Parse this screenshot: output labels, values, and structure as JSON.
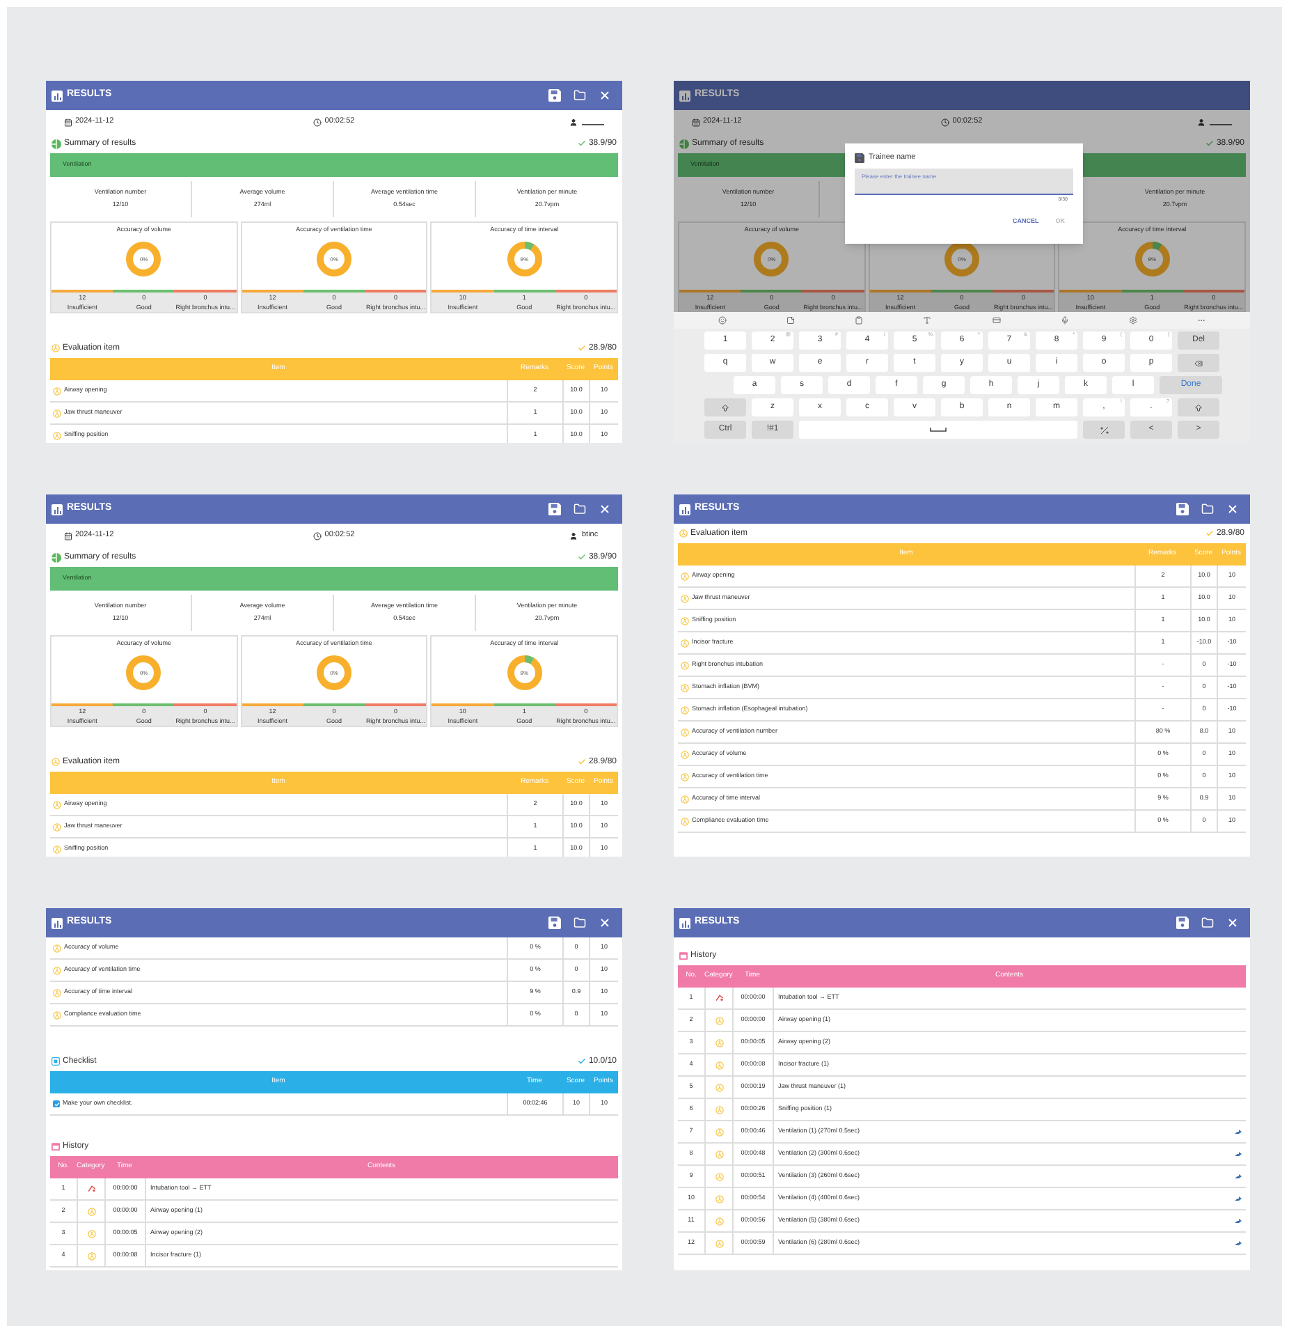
{
  "screens": [
    {
      "title": "RESULTS",
      "show_actions": true,
      "info": {
        "date": "2024-11-12",
        "time": "00:02:52"
      },
      "sections": [
        {
          "kind": "summary",
          "title": "Summary of results",
          "total": "38.9/90",
          "group": "Ventilation",
          "stats": [
            {
              "label": "Ventilation number",
              "value": "12/10"
            },
            {
              "label": "Average volume",
              "value": "274ml"
            },
            {
              "label": "Average ventilation time",
              "value": "0.54sec"
            },
            {
              "label": "Ventilation per minute",
              "value": "20.7vpm"
            }
          ],
          "charts": [
            {
              "title": "Accuracy of volume",
              "center": "0%",
              "legend": [
                {
                  "count": "12",
                  "label": "Insufficient",
                  "color": "#f6a93b"
                },
                {
                  "count": "0",
                  "label": "Good",
                  "color": "#6cbf6e"
                },
                {
                  "count": "0",
                  "label": "Right bronchus intu...",
                  "color": "#ef7c62"
                }
              ]
            },
            {
              "title": "Accuracy of ventilation time",
              "center": "0%",
              "legend": [
                {
                  "count": "12",
                  "label": "Insufficient",
                  "color": "#f6a93b"
                },
                {
                  "count": "0",
                  "label": "Good",
                  "color": "#6cbf6e"
                },
                {
                  "count": "0",
                  "label": "Right bronchus intu...",
                  "color": "#ef7c62"
                }
              ]
            },
            {
              "title": "Accuracy of time interval",
              "center": "9%",
              "legend": [
                {
                  "count": "10",
                  "label": "Insufficient",
                  "color": "#f6a93b"
                },
                {
                  "count": "1",
                  "label": "Good",
                  "color": "#6cbf6e"
                },
                {
                  "count": "0",
                  "label": "Right bronchus intu...",
                  "color": "#ef7c62"
                }
              ]
            }
          ]
        },
        {
          "kind": "evaluation",
          "title": "Evaluation item",
          "total": "28.9/80",
          "columns": [
            "Item",
            "Remarks",
            "Score",
            "Points"
          ],
          "rows": [
            {
              "item": "Airway opening",
              "remarks": "2",
              "score": "10.0",
              "points": "10"
            },
            {
              "item": "Jaw thrust maneuver",
              "remarks": "1",
              "score": "10.0",
              "points": "10"
            },
            {
              "item": "Sniffing position",
              "remarks": "1",
              "score": "10.0",
              "points": "10"
            }
          ]
        }
      ]
    },
    {
      "title": "RESULTS",
      "show_actions": false,
      "info": {
        "date": "2024-11-12",
        "time": "00:02:52"
      },
      "sections": [
        {
          "kind": "summary",
          "title": "Summary of results",
          "total": "38.9/90",
          "group": "Ventilation",
          "stats": [
            {
              "label": "Ventilation number",
              "value": "12/10"
            },
            {
              "label": "Ventilation per minute",
              "value": "20.7vpm"
            }
          ],
          "charts": [
            {
              "title": "Accuracy of volume",
              "center": "0%",
              "legend": [
                {
                  "count": "12",
                  "label": "Insufficient",
                  "color": "#ac7629"
                },
                {
                  "count": "0",
                  "label": "Good",
                  "color": "#4c864d"
                },
                {
                  "count": "0",
                  "label": "Right bronchus intu...",
                  "color": "#a75745"
                }
              ]
            },
            {
              "center": "0%",
              "legend": [
                {
                  "count": "12",
                  "label": "Insufficient",
                  "color": "#ac7629"
                },
                {
                  "count": "0",
                  "label": "Good",
                  "color": "#4c864d"
                },
                {
                  "count": "0",
                  "label": "Right bronchus intu...",
                  "color": "#a75745"
                }
              ]
            },
            {
              "title": "Accuracy of time interval",
              "center": "9%",
              "legend": [
                {
                  "count": "10",
                  "label": "Insufficient",
                  "color": "#ac7629"
                },
                {
                  "count": "1",
                  "label": "Good",
                  "color": "#4c864d"
                },
                {
                  "count": "0",
                  "label": "Right bronchus intu...",
                  "color": "#a75745"
                }
              ]
            }
          ]
        }
      ],
      "dialog": {
        "title": "Trainee name",
        "placeholder": "Please enter the trainee name",
        "counter": "0/30",
        "buttons": [
          {
            "label": "CANCEL",
            "disabled": false
          },
          {
            "label": "OK",
            "disabled": true
          }
        ]
      },
      "keyboard": {
        "rows": [
          [
            {
              "kind": "char",
              "label": "1"
            },
            {
              "kind": "char",
              "label": "2",
              "alt": "@"
            },
            {
              "kind": "char",
              "label": "3",
              "alt": "#"
            },
            {
              "kind": "char",
              "label": "4",
              "alt": "/"
            },
            {
              "kind": "char",
              "label": "5",
              "alt": "%"
            },
            {
              "kind": "char",
              "label": "6",
              "alt": "^"
            },
            {
              "kind": "char",
              "label": "7",
              "alt": "&"
            },
            {
              "kind": "char",
              "label": "8",
              "alt": "*"
            },
            {
              "kind": "char",
              "label": "9",
              "alt": "("
            },
            {
              "kind": "char",
              "label": "0",
              "alt": ")"
            },
            {
              "kind": "action",
              "label": "Del"
            }
          ],
          [
            {
              "kind": "char",
              "label": "q"
            },
            {
              "kind": "char",
              "label": "w"
            },
            {
              "kind": "char",
              "label": "e"
            },
            {
              "kind": "char",
              "label": "r"
            },
            {
              "kind": "char",
              "label": "t"
            },
            {
              "kind": "char",
              "label": "y"
            },
            {
              "kind": "char",
              "label": "u"
            },
            {
              "kind": "char",
              "label": "i"
            },
            {
              "kind": "char",
              "label": "o"
            },
            {
              "kind": "char",
              "label": "p"
            },
            {
              "kind": "backspace"
            }
          ],
          [
            "",
            {
              "kind": "char",
              "label": "a"
            },
            {
              "kind": "char",
              "label": "s"
            },
            {
              "kind": "char",
              "label": "d"
            },
            {
              "kind": "char",
              "label": "f"
            },
            {
              "kind": "char",
              "label": "g"
            },
            {
              "kind": "char",
              "label": "h"
            },
            {
              "kind": "char",
              "label": "j"
            },
            {
              "kind": "char",
              "label": "k"
            },
            {
              "kind": "char",
              "label": "l"
            },
            {
              "kind": "done",
              "label": "Done"
            }
          ],
          [
            {
              "kind": "shift"
            },
            {
              "kind": "char",
              "label": "z"
            },
            {
              "kind": "char",
              "label": "x"
            },
            {
              "kind": "char",
              "label": "c"
            },
            {
              "kind": "char",
              "label": "v"
            },
            {
              "kind": "char",
              "label": "b"
            },
            {
              "kind": "char",
              "label": "n"
            },
            {
              "kind": "char",
              "label": "m"
            },
            {
              "kind": "char",
              "label": ",",
              "alt": "!"
            },
            {
              "kind": "char",
              "label": ".",
              "alt": "?"
            },
            {
              "kind": "shift"
            }
          ],
          [
            {
              "kind": "action",
              "label": "Ctrl"
            },
            {
              "kind": "action",
              "label": "!#1"
            },
            {
              "kind": "space"
            },
            "",
            "",
            "",
            "",
            "",
            {
              "kind": "symbols"
            },
            {
              "kind": "action",
              "label": "<"
            },
            {
              "kind": "action",
              "label": ">"
            }
          ]
        ]
      }
    },
    {
      "title": "RESULTS",
      "show_actions": true,
      "info": {
        "date": "2024-11-12",
        "time": "00:02:52",
        "user": "btinc"
      },
      "sections": [
        {
          "kind": "summary",
          "title": "Summary of results",
          "total": "38.9/90",
          "group": "Ventilation",
          "stats": [
            {
              "label": "Ventilation number",
              "value": "12/10"
            },
            {
              "label": "Average volume",
              "value": "274ml"
            },
            {
              "label": "Average ventilation time",
              "value": "0.54sec"
            },
            {
              "label": "Ventilation per minute",
              "value": "20.7vpm"
            }
          ],
          "charts": [
            {
              "title": "Accuracy of volume",
              "center": "0%",
              "legend": [
                {
                  "count": "12",
                  "label": "Insufficient",
                  "color": "#f6a93b"
                },
                {
                  "count": "0",
                  "label": "Good",
                  "color": "#6cbf6e"
                },
                {
                  "count": "0",
                  "label": "Right bronchus intu...",
                  "color": "#ef7c62"
                }
              ]
            },
            {
              "title": "Accuracy of ventilation time",
              "center": "0%",
              "legend": [
                {
                  "count": "12",
                  "label": "Insufficient",
                  "color": "#f6a93b"
                },
                {
                  "count": "0",
                  "label": "Good",
                  "color": "#6cbf6e"
                },
                {
                  "count": "0",
                  "label": "Right bronchus intu...",
                  "color": "#ef7c62"
                }
              ]
            },
            {
              "title": "Accuracy of time interval",
              "center": "9%",
              "legend": [
                {
                  "count": "10",
                  "label": "Insufficient",
                  "color": "#f6a93b"
                },
                {
                  "count": "1",
                  "label": "Good",
                  "color": "#6cbf6e"
                },
                {
                  "count": "0",
                  "label": "Right bronchus intu...",
                  "color": "#ef7c62"
                }
              ]
            }
          ]
        },
        {
          "kind": "evaluation",
          "title": "Evaluation item",
          "total": "28.9/80",
          "columns": [
            "Item",
            "Remarks",
            "Score",
            "Points"
          ],
          "rows": [
            {
              "item": "Airway opening",
              "remarks": "2",
              "score": "10.0",
              "points": "10"
            },
            {
              "item": "Jaw thrust maneuver",
              "remarks": "1",
              "score": "10.0",
              "points": "10"
            },
            {
              "item": "Sniffing position",
              "remarks": "1",
              "score": "10.0",
              "points": "10"
            }
          ]
        }
      ]
    },
    {
      "title": "RESULTS",
      "show_actions": true,
      "sections": [
        {
          "kind": "evaluation",
          "title": "Evaluation item",
          "total": "28.9/80",
          "columns": [
            "Item",
            "Remarks",
            "Score",
            "Points"
          ],
          "rows": [
            {
              "item": "Airway opening",
              "remarks": "2",
              "score": "10.0",
              "points": "10"
            },
            {
              "item": "Jaw thrust maneuver",
              "remarks": "1",
              "score": "10.0",
              "points": "10"
            },
            {
              "item": "Sniffing position",
              "remarks": "1",
              "score": "10.0",
              "points": "10"
            },
            {
              "item": "Incisor fracture",
              "remarks": "1",
              "score": "-10.0",
              "points": "-10"
            },
            {
              "item": "Right bronchus intubation",
              "remarks": "-",
              "score": "0",
              "points": "-10"
            },
            {
              "item": "Stomach inflation (BVM)",
              "remarks": "-",
              "score": "0",
              "points": "-10"
            },
            {
              "item": "Stomach inflation (Esophageal intubation)",
              "remarks": "-",
              "score": "0",
              "points": "-10"
            },
            {
              "item": "Accuracy of ventilation number",
              "remarks": "80 %",
              "score": "8.0",
              "points": "10"
            },
            {
              "item": "Accuracy of volume",
              "remarks": "0 %",
              "score": "0",
              "points": "10"
            },
            {
              "item": "Accuracy of ventilation time",
              "remarks": "0 %",
              "score": "0",
              "points": "10"
            },
            {
              "item": "Accuracy of time interval",
              "remarks": "9 %",
              "score": "0.9",
              "points": "10"
            },
            {
              "item": "Compliance evaluation time",
              "remarks": "0 %",
              "score": "0",
              "points": "10"
            }
          ]
        }
      ]
    },
    {
      "title": "RESULTS",
      "show_actions": true,
      "sections": [
        {
          "kind": "evaluation",
          "rows": [
            {
              "item": "Accuracy of volume",
              "remarks": "0 %",
              "score": "0",
              "points": "10"
            },
            {
              "item": "Accuracy of ventilation time",
              "remarks": "0 %",
              "score": "0",
              "points": "10"
            },
            {
              "item": "Accuracy of time interval",
              "remarks": "9 %",
              "score": "0.9",
              "points": "10"
            },
            {
              "item": "Compliance evaluation time",
              "remarks": "0 %",
              "score": "0",
              "points": "10"
            }
          ]
        },
        {
          "kind": "checklist",
          "title": "Checklist",
          "total": "10.0/10",
          "columns": [
            "Item",
            "Time",
            "Score",
            "Points"
          ],
          "rows": [
            {
              "item": "Make your own checklist.",
              "checked": true,
              "time": "00:02:46",
              "score": "10",
              "points": "10"
            }
          ]
        },
        {
          "kind": "history",
          "title": "History",
          "columns": [
            "No.",
            "Category",
            "Time",
            "Contents"
          ],
          "rows": [
            {
              "no": "1",
              "kind": "intubation",
              "time": "00:00:00",
              "contents": "Intubation tool → ETT",
              "detail": false
            },
            {
              "no": "2",
              "kind": "evaluation",
              "time": "00:00:00",
              "contents": "Airway opening (1)",
              "detail": false
            },
            {
              "no": "3",
              "kind": "evaluation",
              "time": "00:00:05",
              "contents": "Airway opening (2)",
              "detail": false
            },
            {
              "no": "4",
              "kind": "evaluation",
              "time": "00:00:08",
              "contents": "Incisor fracture (1)",
              "detail": false
            }
          ]
        }
      ]
    },
    {
      "title": "RESULTS",
      "show_actions": true,
      "sections": [
        {
          "kind": "history",
          "title": "History",
          "columns": [
            "No.",
            "Category",
            "Time",
            "Contents"
          ],
          "rows": [
            {
              "no": "1",
              "kind": "intubation",
              "time": "00:00:00",
              "contents": "Intubation tool → ETT",
              "detail": false
            },
            {
              "no": "2",
              "kind": "evaluation",
              "time": "00:00:00",
              "contents": "Airway opening (1)",
              "detail": false
            },
            {
              "no": "3",
              "kind": "evaluation",
              "time": "00:00:05",
              "contents": "Airway opening (2)",
              "detail": false
            },
            {
              "no": "4",
              "kind": "evaluation",
              "time": "00:00:08",
              "contents": "Incisor fracture (1)",
              "detail": false
            },
            {
              "no": "5",
              "kind": "evaluation",
              "time": "00:00:19",
              "contents": "Jaw thrust maneuver (1)",
              "detail": false
            },
            {
              "no": "6",
              "kind": "evaluation",
              "time": "00:00:26",
              "contents": "Sniffing position (1)",
              "detail": false
            },
            {
              "no": "7",
              "kind": "evaluation",
              "time": "00:00:46",
              "contents": "Ventilation (1) (270ml 0.5sec)",
              "detail": true
            },
            {
              "no": "8",
              "kind": "evaluation",
              "time": "00:00:48",
              "contents": "Ventilation (2) (300ml 0.6sec)",
              "detail": true
            },
            {
              "no": "9",
              "kind": "evaluation",
              "time": "00:00:51",
              "contents": "Ventilation (3) (260ml 0.6sec)",
              "detail": true
            },
            {
              "no": "10",
              "kind": "evaluation",
              "time": "00:00:54",
              "contents": "Ventilation (4) (400ml 0.6sec)",
              "detail": true
            },
            {
              "no": "11",
              "kind": "evaluation",
              "time": "00:00:56",
              "contents": "Ventilation (5) (380ml 0.6sec)",
              "detail": true
            },
            {
              "no": "12",
              "kind": "evaluation",
              "time": "00:00:59",
              "contents": "Ventilation (6) (280ml 0.6sec)",
              "detail": true
            }
          ]
        }
      ]
    }
  ]
}
